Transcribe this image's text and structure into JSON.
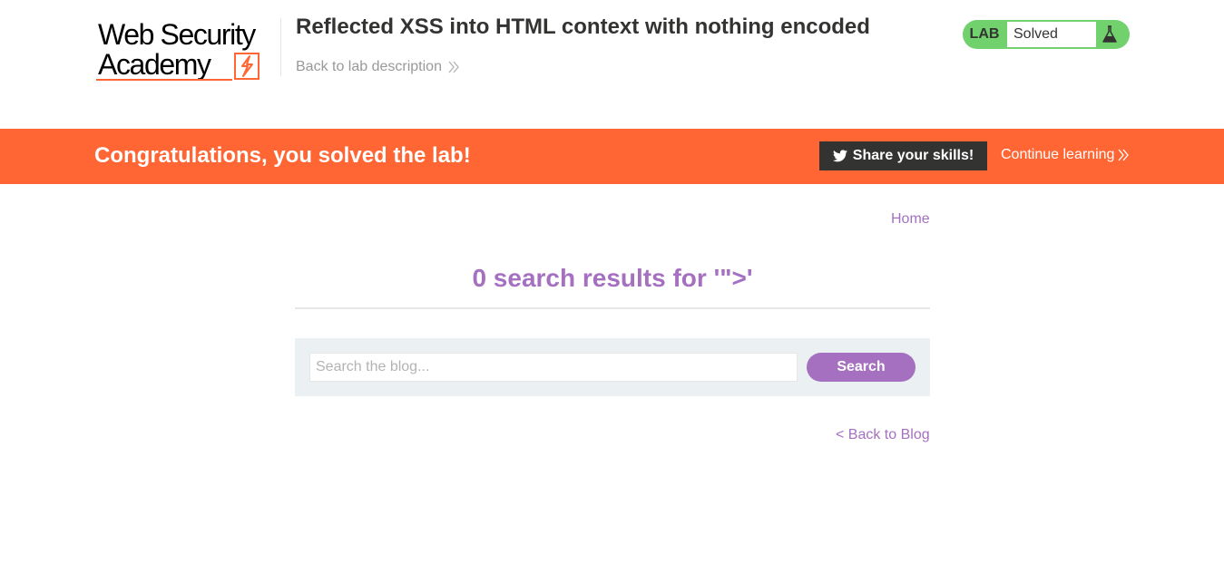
{
  "header": {
    "logo_line1": "Web Security",
    "logo_line2": "Academy",
    "lab_title": "Reflected XSS into HTML context with nothing encoded",
    "back_link": "Back to lab description"
  },
  "status": {
    "tag": "LAB",
    "text": "Solved",
    "icon": "flask-icon"
  },
  "banner": {
    "message": "Congratulations, you solved the lab!",
    "share_label": "Share your skills!",
    "continue_label": "Continue learning"
  },
  "nav": {
    "home": "Home"
  },
  "results": {
    "heading": "0 search results for '\">'"
  },
  "search": {
    "placeholder": "Search the blog...",
    "button": "Search"
  },
  "footer": {
    "back_to_blog": "< Back to Blog"
  },
  "colors": {
    "accent": "#ff6633",
    "link": "#a670c1",
    "solved": "#70d16d",
    "dark": "#333332",
    "panel": "#ebf0f2"
  }
}
